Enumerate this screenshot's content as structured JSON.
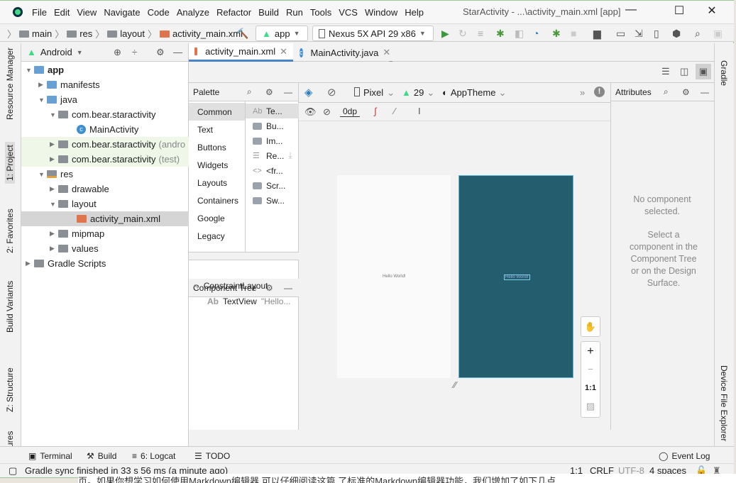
{
  "menu": [
    "File",
    "Edit",
    "View",
    "Navigate",
    "Code",
    "Analyze",
    "Refactor",
    "Build",
    "Run",
    "Tools",
    "VCS",
    "Window",
    "Help"
  ],
  "window_title": "StarActivity - ...\\activity_main.xml [app]",
  "breadcrumb": [
    "main",
    "res",
    "layout",
    "activity_main.xml"
  ],
  "run_config": "app",
  "device": "Nexus 5X API 29 x86",
  "left_tabs": [
    "Resource Manager",
    "1: Project",
    "2: Favorites",
    "Build Variants",
    "Z: Structure",
    "ures"
  ],
  "right_tabs": [
    "Gradle",
    "Device File Explorer"
  ],
  "project": {
    "view": "Android",
    "tree": [
      {
        "label": "app",
        "level": 0,
        "open": true,
        "bold": true
      },
      {
        "label": "manifests",
        "level": 1,
        "open": false
      },
      {
        "label": "java",
        "level": 1,
        "open": true
      },
      {
        "label": "com.bear.staractivity",
        "level": 2,
        "open": true
      },
      {
        "label": "MainActivity",
        "level": 3
      },
      {
        "label": "com.bear.staractivity",
        "suffix": "(andro",
        "level": 2,
        "open": false
      },
      {
        "label": "com.bear.staractivity",
        "suffix": "(test)",
        "level": 2,
        "open": false
      },
      {
        "label": "res",
        "level": 1,
        "open": true
      },
      {
        "label": "drawable",
        "level": 2,
        "open": false
      },
      {
        "label": "layout",
        "level": 2,
        "open": true
      },
      {
        "label": "activity_main.xml",
        "level": 3,
        "selected": true
      },
      {
        "label": "mipmap",
        "level": 2,
        "open": false
      },
      {
        "label": "values",
        "level": 2,
        "open": false
      },
      {
        "label": "Gradle Scripts",
        "level": 0,
        "open": false
      }
    ]
  },
  "tabs": [
    {
      "label": "activity_main.xml",
      "active": true
    },
    {
      "label": "MainActivity.java",
      "active": false
    }
  ],
  "palette": {
    "title": "Palette",
    "categories": [
      "Common",
      "Text",
      "Buttons",
      "Widgets",
      "Layouts",
      "Containers",
      "Google",
      "Legacy"
    ],
    "components": [
      "Te...",
      "Bu...",
      "Im...",
      "Re...",
      "<fr...",
      "Scr...",
      "Sw..."
    ]
  },
  "design_toolbar": {
    "device": "Pixel",
    "api": "29",
    "theme": "AppTheme",
    "margin": "0dp"
  },
  "component_tree": {
    "title": "Component Tree",
    "root": "ConstraintLayout",
    "child": "TextView",
    "child_text": "\"Hello..."
  },
  "preview": {
    "text": "Hello World!",
    "blueprint_color": "#235d6e"
  },
  "zoom": {
    "in": "+",
    "out": "−",
    "fit": "1:1"
  },
  "attributes": {
    "title": "Attributes",
    "empty": "No component selected.",
    "hint": "Select a component in the Component Tree or on the Design Surface."
  },
  "bottom_tools": [
    "Terminal",
    "Build",
    "6: Logcat",
    "TODO"
  ],
  "event_log": "Event Log",
  "status": {
    "message": "Gradle sync finished in 33 s 56 ms (a minute ago)",
    "position": "1:1",
    "line_sep": "CRLF",
    "encoding": "UTF-8",
    "indent": "4 spaces"
  },
  "background_text": "页。如果你想学习如何使用Markdown编辑器,可以仔细阅读这篇                    了标准的Markdown编辑器功能，我们增加了如下几点"
}
